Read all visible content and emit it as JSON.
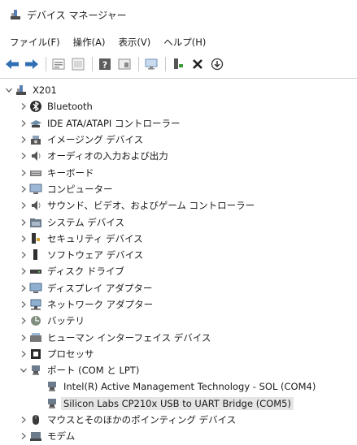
{
  "window": {
    "title": "デバイス マネージャー"
  },
  "menu": [
    {
      "label": "ファイル(F)"
    },
    {
      "label": "操作(A)"
    },
    {
      "label": "表示(V)"
    },
    {
      "label": "ヘルプ(H)"
    }
  ],
  "toolbar": {
    "buttons": [
      "back-arrow-icon",
      "forward-arrow-icon",
      "properties-icon",
      "list-view-icon",
      "help-icon",
      "device-view-icon",
      "monitor-icon",
      "update-driver-icon",
      "uninstall-x-icon",
      "scan-download-icon"
    ]
  },
  "tree": {
    "root": "X201",
    "categories": [
      {
        "label": "Bluetooth",
        "icon": "bluetooth-icon"
      },
      {
        "label": "IDE ATA/ATAPI コントローラー",
        "icon": "ide-controller-icon"
      },
      {
        "label": "イメージング デバイス",
        "icon": "camera-icon"
      },
      {
        "label": "オーディオの入力および出力",
        "icon": "speaker-icon"
      },
      {
        "label": "キーボード",
        "icon": "keyboard-icon"
      },
      {
        "label": "コンピューター",
        "icon": "computer-icon"
      },
      {
        "label": "サウンド、ビデオ、およびゲーム コントローラー",
        "icon": "sound-icon"
      },
      {
        "label": "システム デバイス",
        "icon": "system-folder-icon"
      },
      {
        "label": "セキュリティ デバイス",
        "icon": "security-key-icon"
      },
      {
        "label": "ソフトウェア デバイス",
        "icon": "software-device-icon"
      },
      {
        "label": "ディスク ドライブ",
        "icon": "disk-drive-icon"
      },
      {
        "label": "ディスプレイ アダプター",
        "icon": "display-adapter-icon"
      },
      {
        "label": "ネットワーク アダプター",
        "icon": "network-adapter-icon"
      },
      {
        "label": "バッテリ",
        "icon": "battery-icon"
      },
      {
        "label": "ヒューマン インターフェイス デバイス",
        "icon": "hid-icon"
      },
      {
        "label": "プロセッサ",
        "icon": "processor-icon"
      },
      {
        "label": "ポート (COM と LPT)",
        "icon": "port-icon",
        "expanded": true
      },
      {
        "label": "マウスとそのほかのポインティング デバイス",
        "icon": "mouse-icon"
      },
      {
        "label": "モデム",
        "icon": "modem-icon"
      }
    ],
    "ports_children": [
      {
        "label": "Intel(R) Active Management Technology - SOL (COM4)",
        "icon": "port-icon"
      },
      {
        "label": "Silicon Labs CP210x USB to UART Bridge (COM5)",
        "icon": "port-icon",
        "selected": true
      }
    ]
  }
}
